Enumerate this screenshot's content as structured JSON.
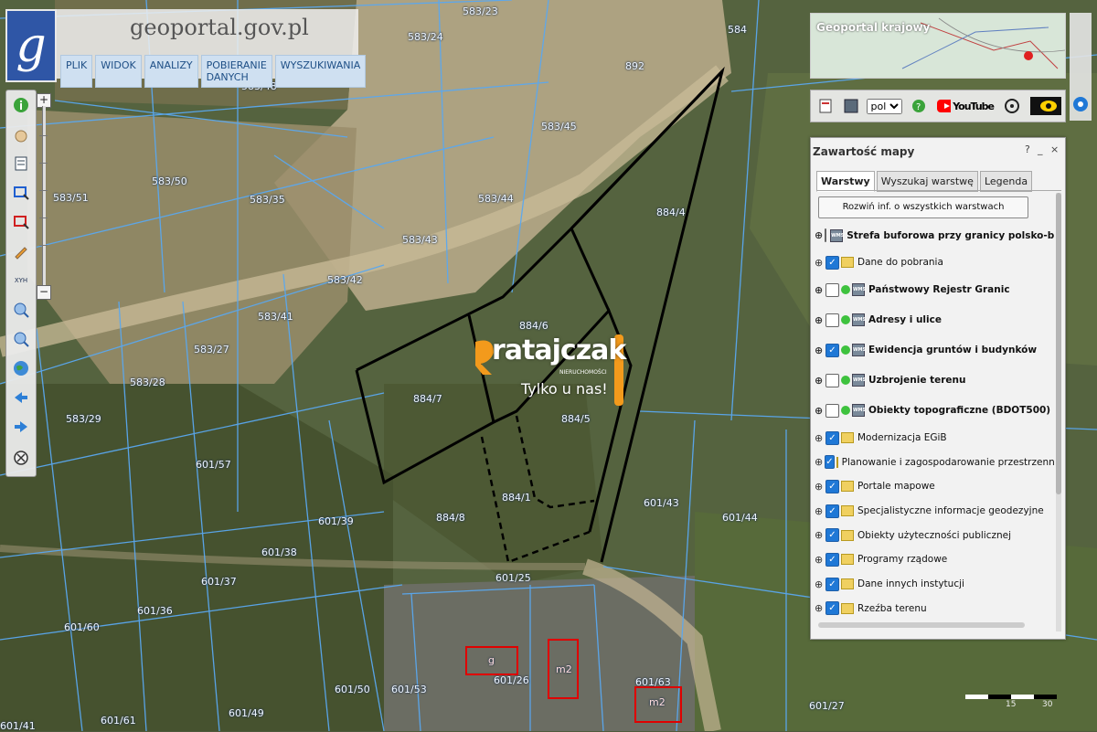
{
  "app": {
    "logo_letter": "g",
    "title": "geoportal.gov.pl",
    "menu": [
      "PLIK",
      "WIDOK",
      "ANALIZY",
      "POBIERANIE DANYCH",
      "WYSZUKIWANIA"
    ]
  },
  "left_toolbar": {
    "tools": [
      "info-icon",
      "hand-pan-icon",
      "legend-icon",
      "select-rect-icon",
      "select-clear-icon",
      "pencil-icon",
      "xyh-icon",
      "zoom-in-icon",
      "zoom-out-icon",
      "globe-icon",
      "back-arrow-icon",
      "forward-arrow-icon",
      "compass-icon"
    ],
    "xyh_label": "XYH",
    "zoom_plus": "+",
    "zoom_minus": "−"
  },
  "overview": {
    "title": "Geoportal krajowy"
  },
  "top_toolbar": {
    "language": "pol",
    "language_options": [
      "pol"
    ],
    "youtube_label": "YouTube"
  },
  "layers_panel": {
    "title": "Zawartość mapy",
    "controls": [
      "?",
      "_",
      "×"
    ],
    "tabs": [
      "Warstwy",
      "Wyszukaj warstwę",
      "Legenda"
    ],
    "active_tab": "Warstwy",
    "expand_all": "Rozwiń inf. o wszystkich warstwach",
    "layers": [
      {
        "label": "Strefa buforowa przy granicy polsko-białoruskiej",
        "checked": false,
        "type": "wms",
        "bold": true
      },
      {
        "label": "Dane do pobrania",
        "checked": true,
        "type": "folder",
        "bold": false
      },
      {
        "label": "Państwowy Rejestr Granic",
        "checked": false,
        "type": "wms",
        "bold": true
      },
      {
        "label": "Adresy i ulice",
        "checked": false,
        "type": "wms",
        "bold": true
      },
      {
        "label": "Ewidencja gruntów i budynków",
        "checked": true,
        "type": "wms",
        "bold": true
      },
      {
        "label": "Uzbrojenie terenu",
        "checked": false,
        "type": "wms",
        "bold": true
      },
      {
        "label": "Obiekty topograficzne (BDOT500)",
        "checked": false,
        "type": "wms",
        "bold": true
      },
      {
        "label": "Modernizacja EGiB",
        "checked": true,
        "type": "folder",
        "bold": false
      },
      {
        "label": "Planowanie i zagospodarowanie przestrzenne",
        "checked": true,
        "type": "folder",
        "bold": false
      },
      {
        "label": "Portale mapowe",
        "checked": true,
        "type": "folder",
        "bold": false
      },
      {
        "label": "Specjalistyczne informacje geodezyjne",
        "checked": true,
        "type": "folder",
        "bold": false
      },
      {
        "label": "Obiekty użyteczności publicznej",
        "checked": true,
        "type": "folder",
        "bold": false
      },
      {
        "label": "Programy rządowe",
        "checked": true,
        "type": "folder",
        "bold": false
      },
      {
        "label": "Dane innych instytucji",
        "checked": true,
        "type": "folder",
        "bold": false
      },
      {
        "label": "Rzeźba terenu",
        "checked": true,
        "type": "folder",
        "bold": false
      }
    ]
  },
  "watermark": {
    "brand": "ratajczak",
    "sub": "NIERUCHOMOŚCI",
    "tagline": "Tylko u nas!"
  },
  "parcels": [
    "583/23",
    "583/24",
    "584",
    "892",
    "583/48",
    "583/45",
    "583/50",
    "583/51",
    "583/35",
    "583/44",
    "884/4",
    "583/43",
    "583/42",
    "583/41",
    "884/6",
    "583/27",
    "583/28",
    "884/7",
    "884/5",
    "583/29",
    "601/57",
    "884/1",
    "884/8",
    "601/43",
    "601/44",
    "601/39",
    "601/38",
    "601/37",
    "601/25",
    "601/36",
    "601/60",
    "601/26",
    "601/63",
    "601/50",
    "601/53",
    "601/49",
    "601/61",
    "601/27",
    "601/41"
  ],
  "buildings": [
    "g",
    "m2",
    "m2"
  ],
  "scale": {
    "labels": [
      "15",
      "30"
    ]
  },
  "colors": {
    "parcel_lines": "#5aa8f0",
    "selection": "#000000",
    "building": "#e00000",
    "brand_orange": "#f39a1c"
  }
}
